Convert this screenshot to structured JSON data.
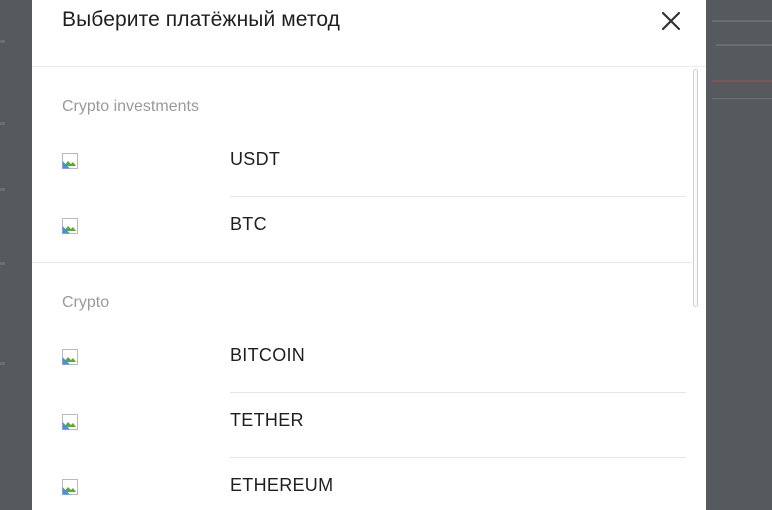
{
  "modal": {
    "title": "Выберите платёжный метод",
    "close_icon": "close-icon"
  },
  "sections": [
    {
      "title": "Crypto investments",
      "methods": [
        {
          "label": "USDT",
          "icon": "broken-image-icon"
        },
        {
          "label": "BTC",
          "icon": "broken-image-icon"
        }
      ]
    },
    {
      "title": "Crypto",
      "methods": [
        {
          "label": "BITCOIN",
          "icon": "broken-image-icon"
        },
        {
          "label": "TETHER",
          "icon": "broken-image-icon"
        },
        {
          "label": "ETHEREUM",
          "icon": "broken-image-icon"
        }
      ]
    }
  ],
  "colors": {
    "overlay": "#56595e",
    "modal_bg": "#ffffff",
    "section_title": "#9a9a9a",
    "text": "#1f1f1f"
  }
}
